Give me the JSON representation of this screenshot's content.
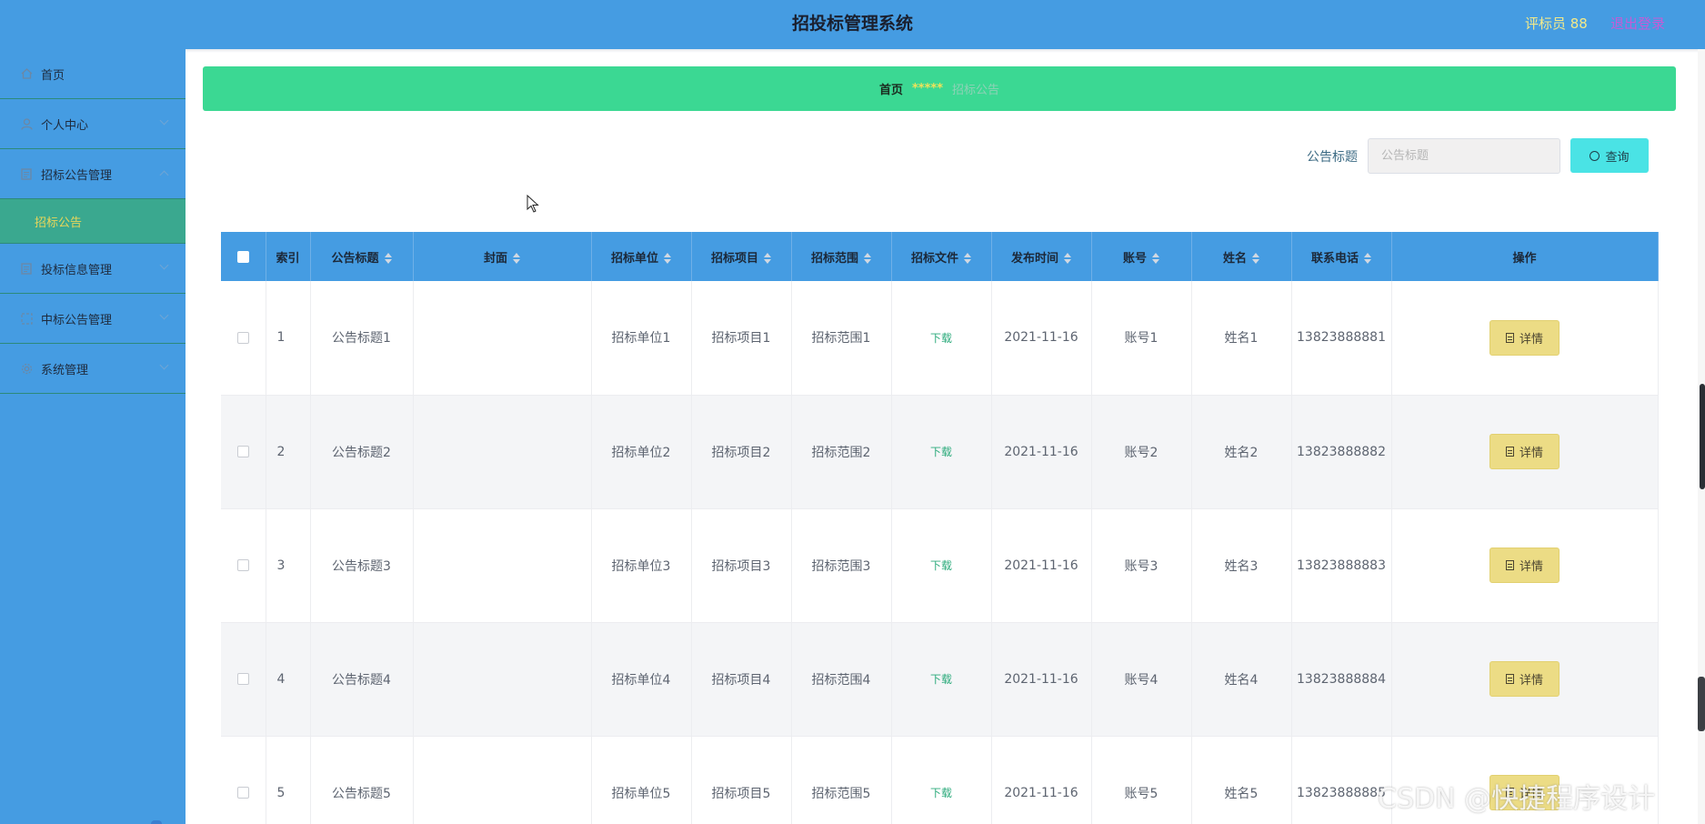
{
  "header": {
    "title": "招投标管理系统",
    "user": "评标员 88",
    "logout": "退出登录"
  },
  "sidebar": {
    "items": [
      {
        "label": "首页",
        "icon": "home-icon"
      },
      {
        "label": "个人中心",
        "icon": "user-icon"
      },
      {
        "label": "招标公告管理",
        "icon": "doc-icon",
        "expanded": true,
        "children": [
          {
            "label": "招标公告",
            "active": true
          }
        ]
      },
      {
        "label": "投标信息管理",
        "icon": "doc-icon"
      },
      {
        "label": "中标公告管理",
        "icon": "grid-icon"
      },
      {
        "label": "系统管理",
        "icon": "gear-icon"
      }
    ]
  },
  "breadcrumb": {
    "home": "首页",
    "separator": "*****",
    "current": "招标公告"
  },
  "search": {
    "label": "公告标题",
    "placeholder": "公告标题",
    "button": "查询"
  },
  "table": {
    "columns": [
      "索引",
      "公告标题",
      "封面",
      "招标单位",
      "招标项目",
      "招标范围",
      "招标文件",
      "发布时间",
      "账号",
      "姓名",
      "联系电话",
      "操作"
    ],
    "download_label": "下载",
    "detail_label": "详情",
    "rows": [
      {
        "index": "1",
        "title": "公告标题1",
        "cover": "",
        "unit": "招标单位1",
        "project": "招标项目1",
        "scope": "招标范围1",
        "date": "2021-11-16",
        "account": "账号1",
        "name": "姓名1",
        "phone": "13823888881"
      },
      {
        "index": "2",
        "title": "公告标题2",
        "cover": "",
        "unit": "招标单位2",
        "project": "招标项目2",
        "scope": "招标范围2",
        "date": "2021-11-16",
        "account": "账号2",
        "name": "姓名2",
        "phone": "13823888882"
      },
      {
        "index": "3",
        "title": "公告标题3",
        "cover": "",
        "unit": "招标单位3",
        "project": "招标项目3",
        "scope": "招标范围3",
        "date": "2021-11-16",
        "account": "账号3",
        "name": "姓名3",
        "phone": "13823888883"
      },
      {
        "index": "4",
        "title": "公告标题4",
        "cover": "",
        "unit": "招标单位4",
        "project": "招标项目4",
        "scope": "招标范围4",
        "date": "2021-11-16",
        "account": "账号4",
        "name": "姓名4",
        "phone": "13823888884"
      },
      {
        "index": "5",
        "title": "公告标题5",
        "cover": "",
        "unit": "招标单位5",
        "project": "招标项目5",
        "scope": "招标范围5",
        "date": "2021-11-16",
        "account": "账号5",
        "name": "姓名5",
        "phone": "13823888885"
      }
    ]
  },
  "watermark": "CSDN @快捷程序设计",
  "colors": {
    "header_bg": "#459ce2",
    "breadcrumb_bg": "#3bd893",
    "search_button": "#4ae3e5",
    "detail_button": "#ecdc85",
    "active_submenu": "#3aa88f"
  }
}
